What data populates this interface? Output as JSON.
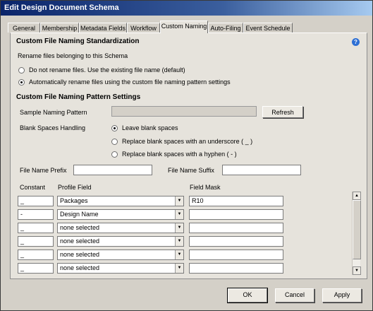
{
  "window": {
    "title": "Edit Design Document Schema"
  },
  "tabs": [
    {
      "label": "General"
    },
    {
      "label": "Membership"
    },
    {
      "label": "Metadata Fields"
    },
    {
      "label": "Workflow"
    },
    {
      "label": "Custom Naming"
    },
    {
      "label": "Auto-Filing"
    },
    {
      "label": "Event Schedule"
    }
  ],
  "active_tab": "Custom Naming",
  "standardization": {
    "title": "Custom File Naming Standardization",
    "rename_label": "Rename files belonging to this Schema",
    "options": [
      {
        "label": "Do not rename files. Use the existing file name (default)",
        "checked": false
      },
      {
        "label": "Automatically rename files using the custom file naming pattern settings",
        "checked": true
      }
    ],
    "help_icon": "help-icon"
  },
  "pattern": {
    "title": "Custom File Naming Pattern Settings",
    "sample_label": "Sample Naming Pattern",
    "sample_value": "",
    "refresh_label": "Refresh",
    "blank_label": "Blank Spaces Handling",
    "blank_options": [
      {
        "label": "Leave blank spaces",
        "checked": true
      },
      {
        "label": "Replace blank spaces with an underscore ( _ )",
        "checked": false
      },
      {
        "label": "Replace blank spaces with a hyphen ( - )",
        "checked": false
      }
    ],
    "prefix_label": "File Name Prefix",
    "prefix_value": "",
    "suffix_label": "File Name Suffix",
    "suffix_value": ""
  },
  "table": {
    "headers": {
      "constant": "Constant",
      "profile": "Profile Field",
      "mask": "Field Mask"
    },
    "rows": [
      {
        "constant": "_",
        "profile": "Packages",
        "mask": "R10"
      },
      {
        "constant": "-",
        "profile": "Design Name",
        "mask": ""
      },
      {
        "constant": "_",
        "profile": "none selected",
        "mask": ""
      },
      {
        "constant": "_",
        "profile": "none selected",
        "mask": ""
      },
      {
        "constant": "_",
        "profile": "none selected",
        "mask": ""
      },
      {
        "constant": "_",
        "profile": "none selected",
        "mask": ""
      }
    ]
  },
  "footer": {
    "ok_label": "OK",
    "cancel_label": "Cancel",
    "apply_label": "Apply"
  }
}
